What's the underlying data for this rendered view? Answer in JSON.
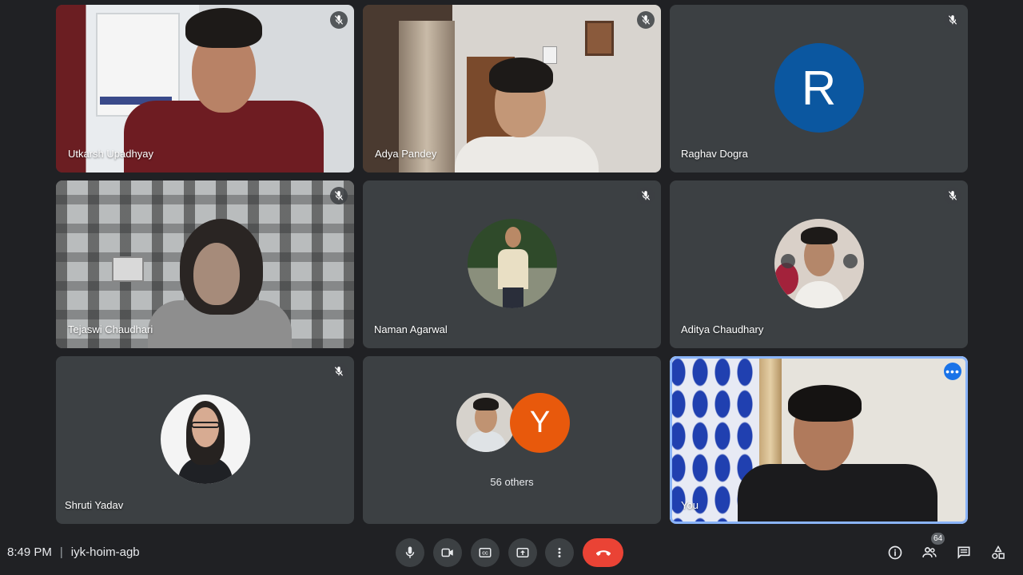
{
  "participants": [
    {
      "name": "Utkarsh Upadhyay",
      "muted": true,
      "video": true
    },
    {
      "name": "Adya Pandey",
      "muted": true,
      "video": true
    },
    {
      "name": "Raghav Dogra",
      "muted": true,
      "video": false,
      "initial": "R",
      "avatar_color": "#0b57a0"
    },
    {
      "name": "Tejaswi Chaudhari",
      "muted": true,
      "video": true
    },
    {
      "name": "Naman Agarwal",
      "muted": true,
      "video": false
    },
    {
      "name": "Aditya Chaudhary",
      "muted": true,
      "video": false
    },
    {
      "name": "Shruti Yadav",
      "muted": true,
      "video": false
    },
    {
      "name": "You",
      "muted": false,
      "video": true,
      "highlighted": true
    }
  ],
  "others_tile": {
    "label": "56 others",
    "initial": "Y",
    "avatar_color": "#e8590c"
  },
  "footer": {
    "time": "8:49 PM",
    "meeting_code": "iyk-hoim-agb",
    "participant_count": "64"
  },
  "controls": [
    {
      "icon": "microphone-icon"
    },
    {
      "icon": "camera-icon"
    },
    {
      "icon": "captions-icon"
    },
    {
      "icon": "present-screen-icon"
    },
    {
      "icon": "more-options-icon"
    },
    {
      "icon": "hang-up-icon"
    }
  ],
  "side_controls": [
    {
      "icon": "info-icon"
    },
    {
      "icon": "people-icon"
    },
    {
      "icon": "chat-icon"
    },
    {
      "icon": "activities-icon"
    }
  ],
  "colors": {
    "background": "#202124",
    "tile": "#3c4043",
    "hangup": "#ea4335",
    "accent": "#8ab4f8"
  }
}
